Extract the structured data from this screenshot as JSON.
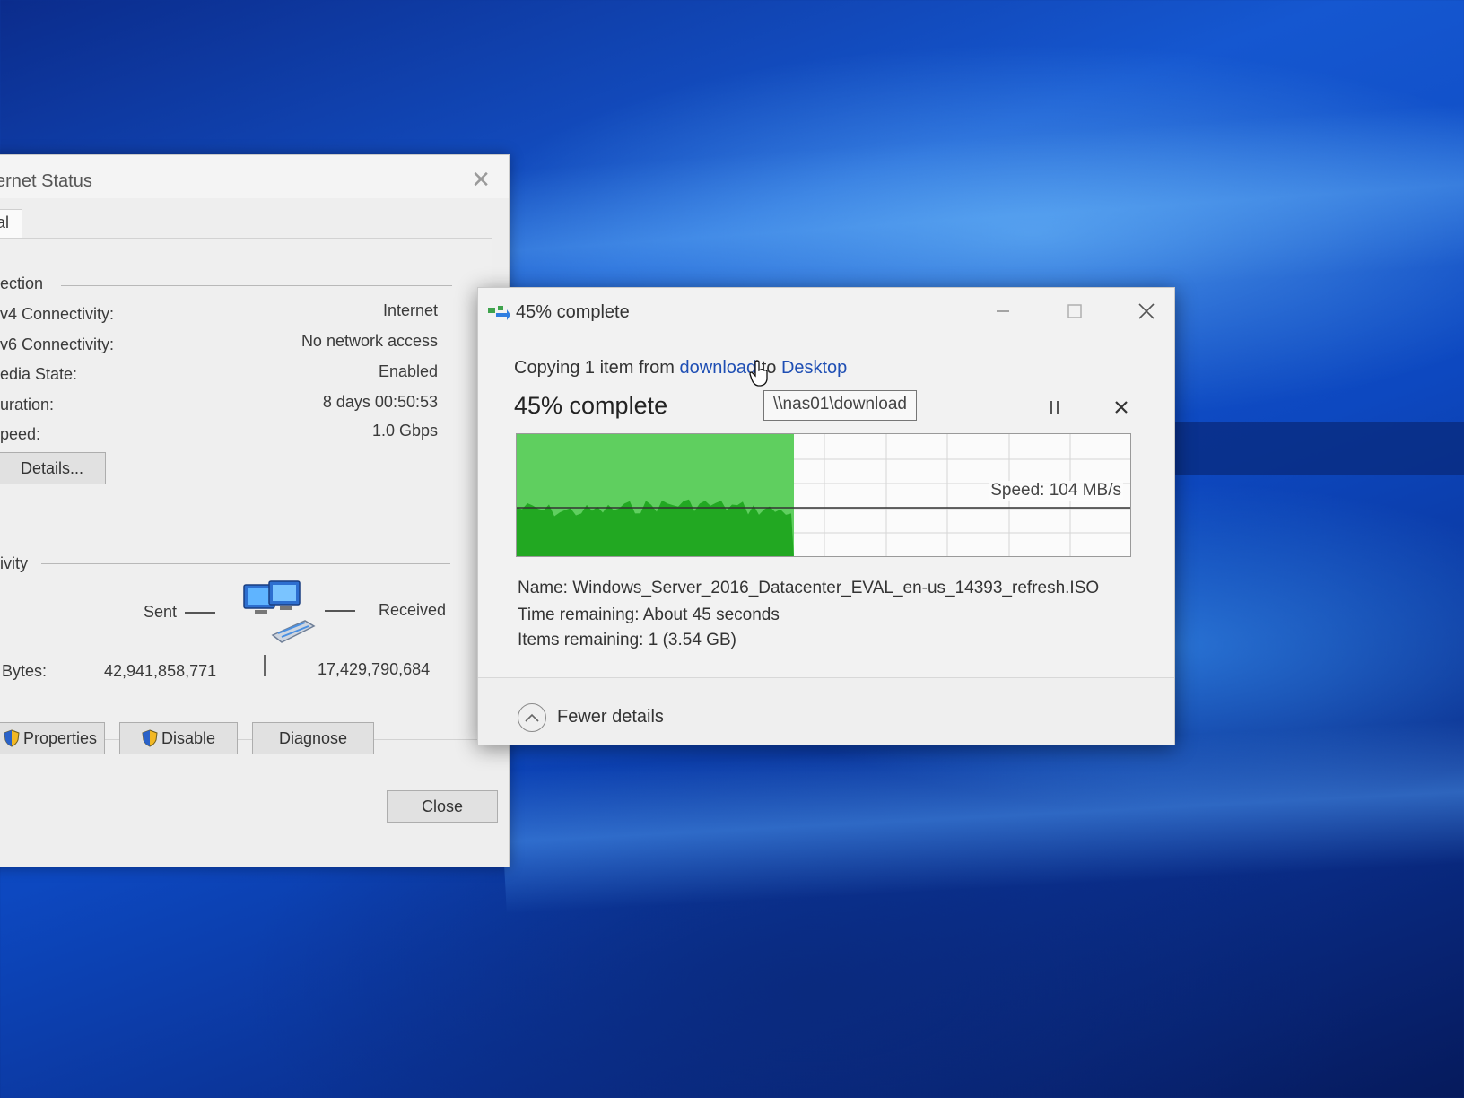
{
  "ethernet": {
    "title": "ernet Status",
    "tab_label": "al",
    "connection_section": "ection",
    "rows": [
      {
        "label": "v4 Connectivity:",
        "value": "Internet"
      },
      {
        "label": "v6 Connectivity:",
        "value": "No network access"
      },
      {
        "label": "edia State:",
        "value": "Enabled"
      },
      {
        "label": "uration:",
        "value": "8 days 00:50:53"
      },
      {
        "label": "peed:",
        "value": "1.0 Gbps"
      }
    ],
    "details_button": "Details...",
    "activity_section": "ivity",
    "sent_label": "Sent",
    "received_label": "Received",
    "bytes_label": "Bytes:",
    "bytes_sent": "42,941,858,771",
    "bytes_received": "17,429,790,684",
    "properties_button": "Properties",
    "disable_button": "Disable",
    "diagnose_button": "Diagnose",
    "close_button": "Close"
  },
  "copy_dialog": {
    "title": "45% complete",
    "subtitle_prefix": "Copying 1 item from ",
    "source_link": "download",
    "subtitle_mid": " to ",
    "dest_link": "Desktop",
    "big_status": "45% complete",
    "tooltip": "\\\\nas01\\download",
    "progress_percent": 45,
    "speed_label": "Speed: 104 MB/s",
    "name_label": "Name: ",
    "name_value": "Windows_Server_2016_Datacenter_EVAL_en-us_14393_refresh.ISO",
    "time_label": "Time remaining: ",
    "time_value": "About 45 seconds",
    "items_label": "Items remaining: ",
    "items_value": "1 (3.54 GB)",
    "fewer_details": "Fewer details",
    "colors": {
      "progress_fill": "#5fcf5f",
      "speed_area": "#22a822",
      "link": "#1f4fb4"
    }
  },
  "icons": [
    "copy-icon",
    "minimize-icon",
    "maximize-icon",
    "close-icon",
    "pause-icon",
    "stop-icon",
    "chevron-up-icon",
    "network-computers-icon",
    "shield-icon",
    "hand-cursor-icon"
  ]
}
